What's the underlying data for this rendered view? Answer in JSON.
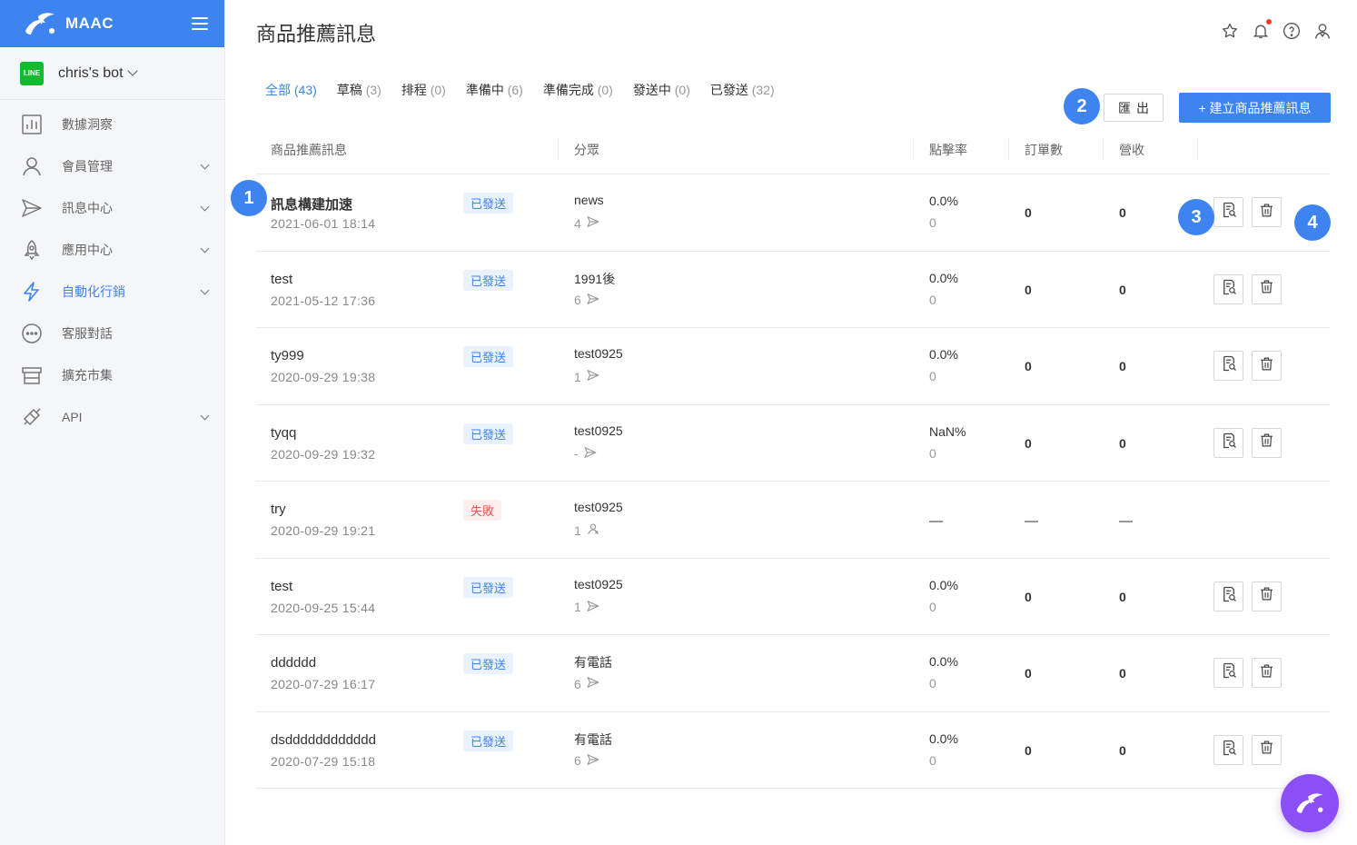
{
  "app": {
    "name": "MAAC"
  },
  "bot": {
    "badge": "LINE",
    "name": "chris's bot"
  },
  "nav": [
    {
      "label": "數據洞察",
      "icon": "chart-icon",
      "expandable": false,
      "active": false
    },
    {
      "label": "會員管理",
      "icon": "user-icon",
      "expandable": true,
      "active": false
    },
    {
      "label": "訊息中心",
      "icon": "send-icon",
      "expandable": true,
      "active": false
    },
    {
      "label": "應用中心",
      "icon": "rocket-icon",
      "expandable": true,
      "active": false
    },
    {
      "label": "自動化行銷",
      "icon": "lightning-icon",
      "expandable": true,
      "active": true
    },
    {
      "label": "客服對話",
      "icon": "chat-icon",
      "expandable": false,
      "active": false
    },
    {
      "label": "擴充市集",
      "icon": "store-icon",
      "expandable": false,
      "active": false
    },
    {
      "label": "API",
      "icon": "plug-icon",
      "expandable": true,
      "active": false
    }
  ],
  "page": {
    "title": "商品推薦訊息"
  },
  "tabs": [
    {
      "label": "全部",
      "count": "(43)",
      "active": true
    },
    {
      "label": "草稿",
      "count": "(3)",
      "active": false
    },
    {
      "label": "排程",
      "count": "(0)",
      "active": false
    },
    {
      "label": "準備中",
      "count": "(6)",
      "active": false
    },
    {
      "label": "準備完成",
      "count": "(0)",
      "active": false
    },
    {
      "label": "發送中",
      "count": "(0)",
      "active": false
    },
    {
      "label": "已發送",
      "count": "(32)",
      "active": false
    }
  ],
  "buttons": {
    "export": "匯出",
    "create": "+ 建立商品推薦訊息"
  },
  "columns": [
    "商品推薦訊息",
    "分眾",
    "點擊率",
    "訂單數",
    "營收"
  ],
  "rows": [
    {
      "name": "訊息構建加速",
      "date": "2021-06-01 18:14",
      "status": "已發送",
      "status_type": "sent",
      "audience": "news",
      "audience_count": "4",
      "ctr": "0.0%",
      "clicks": "0",
      "orders": "0",
      "revenue": "0",
      "actions": true,
      "bold": true
    },
    {
      "name": "test",
      "date": "2021-05-12 17:36",
      "status": "已發送",
      "status_type": "sent",
      "audience": "1991後",
      "audience_count": "6",
      "ctr": "0.0%",
      "clicks": "0",
      "orders": "0",
      "revenue": "0",
      "actions": true
    },
    {
      "name": "ty999",
      "date": "2020-09-29 19:38",
      "status": "已發送",
      "status_type": "sent",
      "audience": "test0925",
      "audience_count": "1",
      "ctr": "0.0%",
      "clicks": "0",
      "orders": "0",
      "revenue": "0",
      "actions": true
    },
    {
      "name": "tyqq",
      "date": "2020-09-29 19:32",
      "status": "已發送",
      "status_type": "sent",
      "audience": "test0925",
      "audience_count": "-",
      "ctr": "NaN%",
      "clicks": "0",
      "orders": "0",
      "revenue": "0",
      "actions": true
    },
    {
      "name": "try",
      "date": "2020-09-29 19:21",
      "status": "失敗",
      "status_type": "fail",
      "audience": "test0925",
      "audience_count": "1",
      "ctr": "—",
      "clicks": "",
      "orders": "—",
      "revenue": "—",
      "actions": false
    },
    {
      "name": "test",
      "date": "2020-09-25 15:44",
      "status": "已發送",
      "status_type": "sent",
      "audience": "test0925",
      "audience_count": "1",
      "ctr": "0.0%",
      "clicks": "0",
      "orders": "0",
      "revenue": "0",
      "actions": true
    },
    {
      "name": "dddddd",
      "date": "2020-07-29 16:17",
      "status": "已發送",
      "status_type": "sent",
      "audience": "有電話",
      "audience_count": "6",
      "ctr": "0.0%",
      "clicks": "0",
      "orders": "0",
      "revenue": "0",
      "actions": true
    },
    {
      "name": "dsdddddddddddd",
      "date": "2020-07-29 15:18",
      "status": "已發送",
      "status_type": "sent",
      "audience": "有電話",
      "audience_count": "6",
      "ctr": "0.0%",
      "clicks": "0",
      "orders": "0",
      "revenue": "0",
      "actions": true
    }
  ],
  "callouts": [
    "1",
    "2",
    "3",
    "4"
  ],
  "colors": {
    "primary": "#3d84f0",
    "fail": "#f25656",
    "fab": "#8a4ff5",
    "line": "#13b92f"
  }
}
